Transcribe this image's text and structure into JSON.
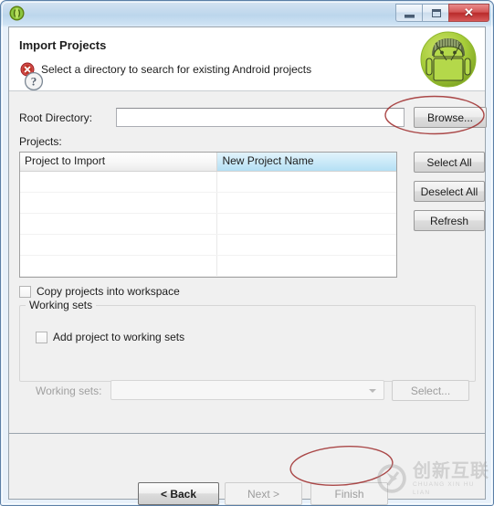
{
  "window": {
    "title": "",
    "title_redacted": true,
    "app_icon": "eclipse-icon",
    "controls": {
      "minimize_label": "",
      "maximize_label": "",
      "close_label": "✕"
    }
  },
  "header": {
    "title": "Import Projects",
    "status_icon": "error-icon",
    "message": "Select a directory to search for existing Android projects",
    "badge_icon": "android-robot-icon"
  },
  "form": {
    "root_directory": {
      "label": "Root Directory:",
      "value": "",
      "placeholder": ""
    },
    "browse_button": "Browse...",
    "projects_label": "Projects:"
  },
  "table": {
    "columns": [
      "Project to Import",
      "New Project Name"
    ],
    "highlighted_column": "New Project Name",
    "rows": [
      [
        "",
        ""
      ],
      [
        "",
        ""
      ],
      [
        "",
        ""
      ],
      [
        "",
        ""
      ],
      [
        "",
        ""
      ],
      [
        "",
        ""
      ]
    ]
  },
  "side_buttons": [
    {
      "label": "Select All",
      "name": "select-all-button",
      "enabled": true
    },
    {
      "label": "Deselect All",
      "name": "deselect-all-button",
      "enabled": true
    },
    {
      "label": "Refresh",
      "name": "refresh-button",
      "enabled": true
    }
  ],
  "options": {
    "copy_projects": {
      "label": "Copy projects into workspace",
      "checked": false
    }
  },
  "working_sets": {
    "group_title": "Working sets",
    "add_to_working_sets": {
      "label": "Add project to working sets",
      "checked": false,
      "enabled": true
    },
    "combo_label": "Working sets:",
    "combo_value": "",
    "combo_enabled": false,
    "select_button": "Select...",
    "select_enabled": false
  },
  "footer": {
    "help_icon": "question-mark-icon",
    "buttons": [
      {
        "label": "< Back",
        "name": "back-button",
        "enabled": true,
        "default": true
      },
      {
        "label": "Next >",
        "name": "next-button",
        "enabled": false
      },
      {
        "label": "Finish",
        "name": "finish-button",
        "enabled": false
      }
    ]
  },
  "annotations": [
    {
      "name": "highlight-ellipse-browse",
      "target": "Browse...",
      "color": "#9e2a2a"
    },
    {
      "name": "highlight-ellipse-finish",
      "target": "Finish",
      "color": "#9e2a2a"
    }
  ],
  "watermark": {
    "logo_icon": "circle-x-logo-icon",
    "chinese": "创新互联",
    "pinyin": "CHUANG XIN HU LIAN"
  },
  "colors": {
    "accent_blue": "#b4e0f4",
    "error_red": "#c0392b",
    "annotation_red": "#9e2a2a",
    "android_green": "#a4c639",
    "frame_blue": "#5b7fa6"
  }
}
